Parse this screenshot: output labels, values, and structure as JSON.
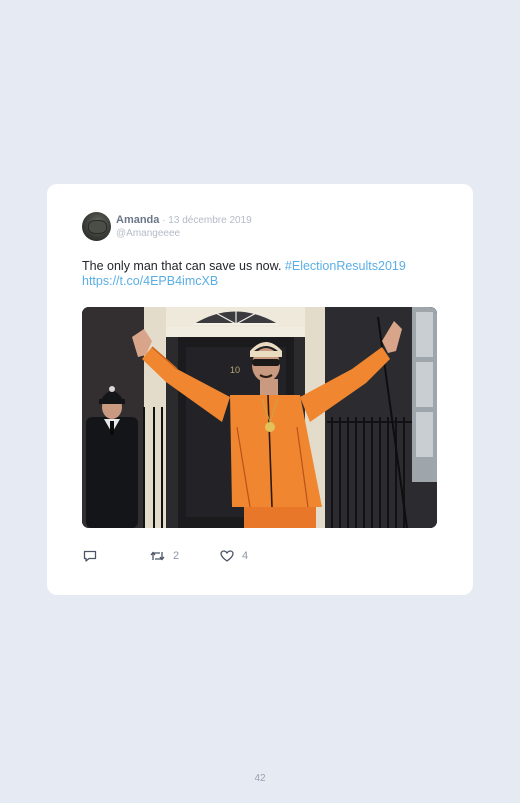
{
  "tweet": {
    "author_name": "Amanda",
    "separator": " · ",
    "date": "13 décembre 2019",
    "handle": "@Amangeeee",
    "text": "The only man that can save us now. ",
    "hashtag": "#ElectionResults2019",
    "link": "https://t.co/4EPB4imcXB",
    "media_icon": "photo-of-man-in-orange-tracksuit-with-raised-arms",
    "door_number": "10"
  },
  "actions": {
    "reply_icon": "reply-icon",
    "retweet_icon": "retweet-icon",
    "retweet_count": "2",
    "like_icon": "heart-icon",
    "like_count": "4"
  },
  "page": {
    "number": "42"
  },
  "colors": {
    "background": "#e6eaf3",
    "card": "#ffffff",
    "link": "#5aaee6",
    "muted": "#b4bac6",
    "tracksuit": "#f0862f"
  }
}
